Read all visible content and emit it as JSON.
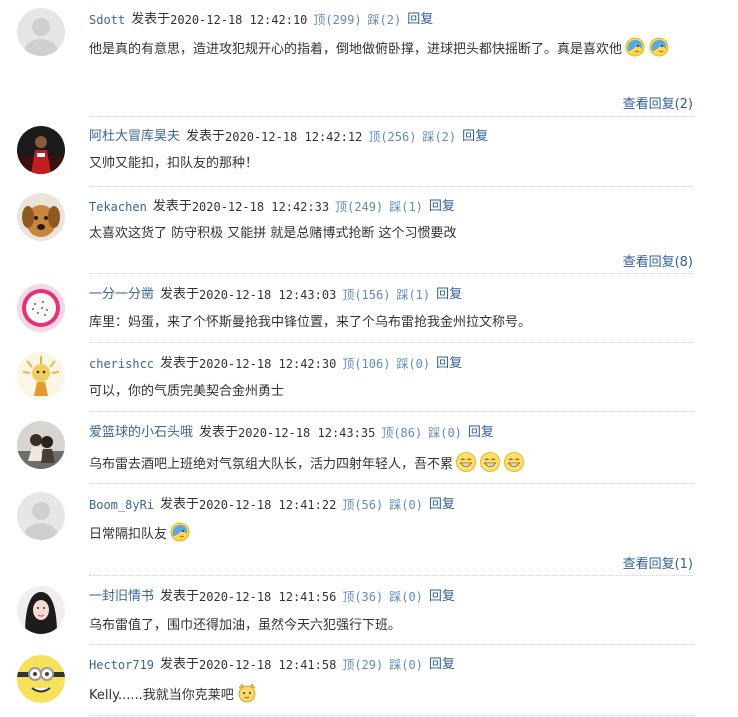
{
  "labels": {
    "posted": "发表于",
    "reply": "回复"
  },
  "comments": [
    {
      "username": "Sdott",
      "time": "2020-12-18 12:42:10",
      "up": "顶(299)",
      "down": "踩(2)",
      "text": "他是真的有意思，造进攻犯规开心的指着，倒地做俯卧撑，进球把头都快摇断了。真是喜欢他",
      "emojis": [
        "blue-hug-emoji",
        "blue-hug-emoji"
      ],
      "view_replies": "查看回复(2)",
      "avatar": "default-avatar"
    },
    {
      "username": "阿杜大冒库昊夫",
      "time": "2020-12-18 12:42:12",
      "up": "顶(256)",
      "down": "踩(2)",
      "text": "又帅又能扣，扣队友的那种！",
      "emojis": [],
      "view_replies": "",
      "avatar": "basketball-player-avatar"
    },
    {
      "username": "Tekachen",
      "time": "2020-12-18 12:42:33",
      "up": "顶(249)",
      "down": "踩(1)",
      "text": "太喜欢这货了 防守积极 又能拼 就是总赌博式抢断 这个习惯要改",
      "emojis": [],
      "view_replies": "查看回复(8)",
      "avatar": "dog-avatar"
    },
    {
      "username": "一分一分凿",
      "time": "2020-12-18 12:43:03",
      "up": "顶(156)",
      "down": "踩(1)",
      "text": "库里：妈蛋，来了个怀斯曼抢我中锋位置，来了个乌布雷抢我金州拉文称号。",
      "emojis": [],
      "view_replies": "",
      "avatar": "dragonfruit-avatar"
    },
    {
      "username": "cherishcc",
      "time": "2020-12-18 12:42:30",
      "up": "顶(106)",
      "down": "踩(0)",
      "text": "可以，你的气质完美契合金州勇士",
      "emojis": [],
      "view_replies": "",
      "avatar": "cartoon-figure-avatar"
    },
    {
      "username": "爱篮球的小石头哦",
      "time": "2020-12-18 12:43:35",
      "up": "顶(86)",
      "down": "踩(0)",
      "text": "乌布雷去酒吧上班绝对气氛组大队长，活力四射年轻人，吾不累",
      "emojis": [
        "grin-emoji",
        "grin-emoji",
        "grin-emoji"
      ],
      "view_replies": "",
      "avatar": "couple-photo-avatar"
    },
    {
      "username": "Boom_8yRi",
      "time": "2020-12-18 12:41:22",
      "up": "顶(56)",
      "down": "踩(0)",
      "text": "日常隔扣队友",
      "emojis": [
        "blue-hug-emoji"
      ],
      "view_replies": "查看回复(1)",
      "avatar": "default-avatar"
    },
    {
      "username": "一封旧情书",
      "time": "2020-12-18 12:41:56",
      "up": "顶(36)",
      "down": "踩(0)",
      "text": "乌布雷值了，围巾还得加油，虽然今天六犯强行下班。",
      "emojis": [],
      "view_replies": "",
      "avatar": "portrait-avatar"
    },
    {
      "username": "Hector719",
      "time": "2020-12-18 12:41:58",
      "up": "顶(29)",
      "down": "踩(0)",
      "text": "Kelly......我就当你克莱吧",
      "emojis": [
        "cat-face-emoji"
      ],
      "view_replies": "",
      "avatar": "minion-avatar"
    }
  ]
}
